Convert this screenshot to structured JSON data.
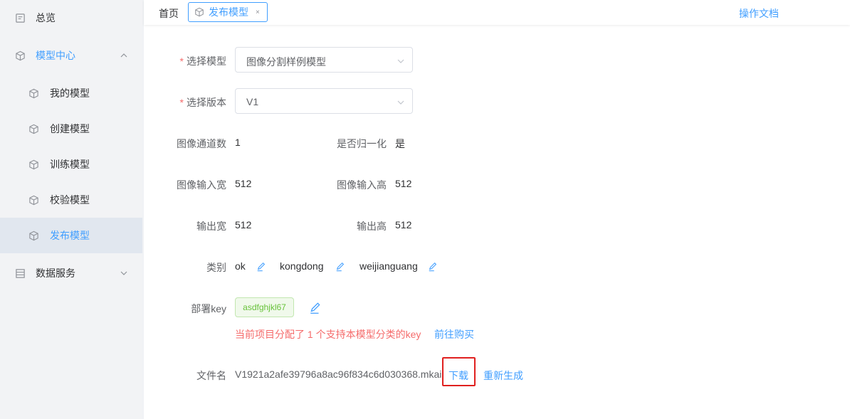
{
  "sidebar": {
    "items": [
      {
        "label": "总览",
        "icon": "overview-icon"
      },
      {
        "label": "模型中心",
        "icon": "cube-icon"
      },
      {
        "label": "我的模型",
        "icon": "cube-icon"
      },
      {
        "label": "创建模型",
        "icon": "cube-icon"
      },
      {
        "label": "训练模型",
        "icon": "cube-icon"
      },
      {
        "label": "校验模型",
        "icon": "cube-icon"
      },
      {
        "label": "发布模型",
        "icon": "cube-icon"
      },
      {
        "label": "数据服务",
        "icon": "database-icon"
      }
    ]
  },
  "tabs": {
    "home": "首页",
    "active": "发布模型",
    "close": "×"
  },
  "header": {
    "doc_link": "操作文档"
  },
  "form": {
    "model_label": "选择模型",
    "model_value": "图像分割样例模型",
    "version_label": "选择版本",
    "version_value": "V1",
    "channels_label": "图像通道数",
    "channels_value": "1",
    "normalize_label": "是否归一化",
    "normalize_value": "是",
    "input_w_label": "图像输入宽",
    "input_w_value": "512",
    "input_h_label": "图像输入高",
    "input_h_value": "512",
    "output_w_label": "输出宽",
    "output_w_value": "512",
    "output_h_label": "输出高",
    "output_h_value": "512",
    "category_label": "类别",
    "categories": [
      "ok",
      "kongdong",
      "weijianguang"
    ],
    "key_label": "部署key",
    "key_value": "asdfghjkl67",
    "key_hint": "当前项目分配了 1 个支持本模型分类的key",
    "buy_link": "前往购买",
    "file_label": "文件名",
    "file_value": "V1921a2afe39796a8ac96f834c6d030368.mkai",
    "download_link": "下载",
    "regenerate_link": "重新生成"
  },
  "colors": {
    "accent": "#409eff",
    "danger": "#f56c6c",
    "success": "#67c23a",
    "highlight": "#e0201f"
  }
}
